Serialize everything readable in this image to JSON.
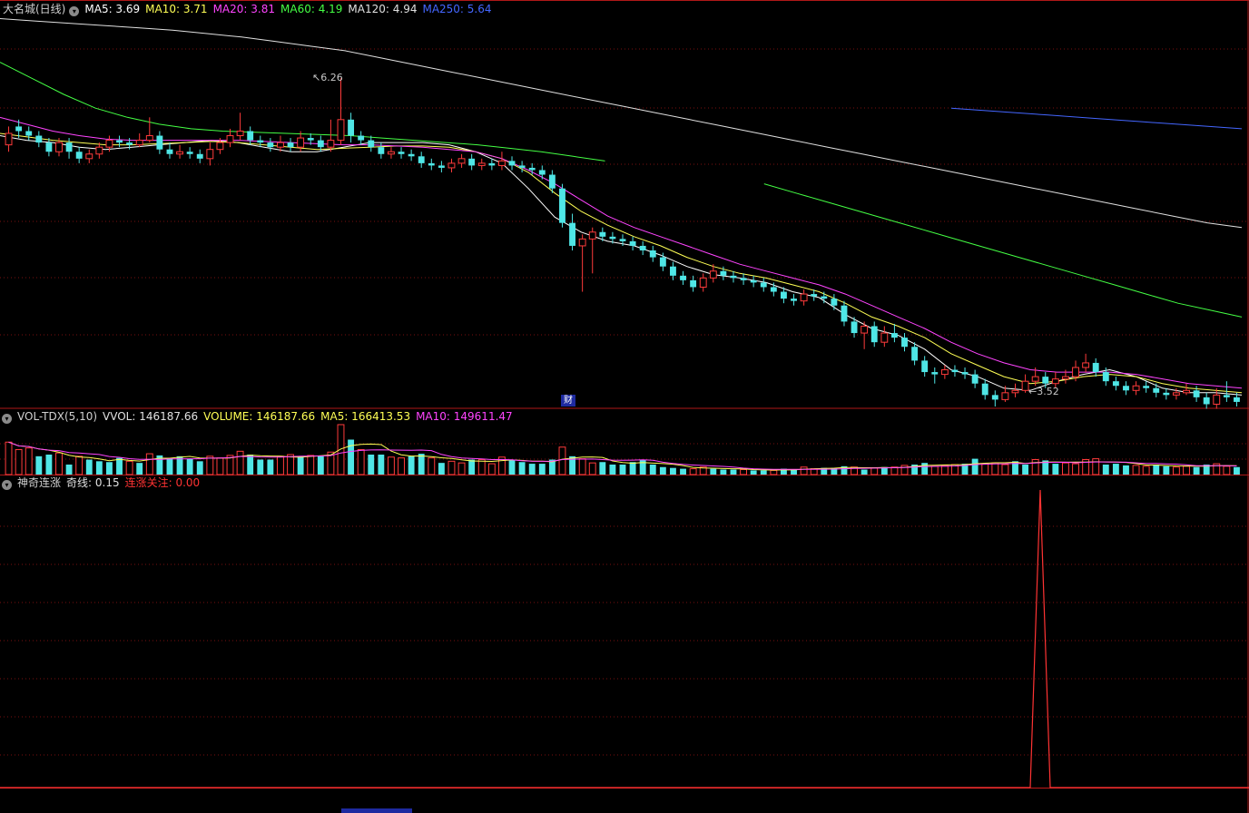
{
  "main_panel": {
    "title": "大名城(日线)",
    "indicators": [
      {
        "label": "MA5: 3.69",
        "color": "#ffffff"
      },
      {
        "label": "MA10: 3.71",
        "color": "#ffff55"
      },
      {
        "label": "MA20: 3.81",
        "color": "#ff44ff"
      },
      {
        "label": "MA60: 4.19",
        "color": "#44ff44"
      },
      {
        "label": "MA120: 4.94",
        "color": "#e0e0e0"
      },
      {
        "label": "MA250: 5.64",
        "color": "#4466ff"
      }
    ],
    "high_label": "6.26",
    "low_label": "3.52",
    "finance_badge": "财"
  },
  "volume_panel": {
    "title": "VOL-TDX(5,10)",
    "indicators": [
      {
        "label": "VVOL: 146187.66",
        "color": "#e0e0e0"
      },
      {
        "label": "VOLUME: 146187.66",
        "color": "#ffff55"
      },
      {
        "label": "MA5: 166413.53",
        "color": "#ffff55"
      },
      {
        "label": "MA10: 149611.47",
        "color": "#ff44ff"
      }
    ]
  },
  "signal_panel": {
    "title": "神奇连涨",
    "indicators": [
      {
        "label": "奇线: 0.15",
        "color": "#e0e0e0"
      },
      {
        "label": "连涨关注: 0.00",
        "color": "#ff3333"
      }
    ]
  },
  "chart_data": {
    "type": "candlestick",
    "price_range": [
      3.4,
      6.8
    ],
    "candles": [
      [
        5.68,
        5.78,
        5.84,
        5.62
      ],
      [
        5.84,
        5.8,
        5.9,
        5.74
      ],
      [
        5.8,
        5.76,
        5.84,
        5.72
      ],
      [
        5.76,
        5.7,
        5.8,
        5.66
      ],
      [
        5.7,
        5.62,
        5.74,
        5.58
      ],
      [
        5.62,
        5.7,
        5.74,
        5.58
      ],
      [
        5.7,
        5.62,
        5.74,
        5.56
      ],
      [
        5.62,
        5.56,
        5.66,
        5.52
      ],
      [
        5.56,
        5.6,
        5.64,
        5.52
      ],
      [
        5.6,
        5.66,
        5.7,
        5.56
      ],
      [
        5.66,
        5.72,
        5.76,
        5.62
      ],
      [
        5.72,
        5.7,
        5.76,
        5.66
      ],
      [
        5.7,
        5.68,
        5.74,
        5.64
      ],
      [
        5.68,
        5.72,
        5.78,
        5.66
      ],
      [
        5.72,
        5.76,
        5.92,
        5.7
      ],
      [
        5.76,
        5.64,
        5.8,
        5.6
      ],
      [
        5.64,
        5.6,
        5.7,
        5.56
      ],
      [
        5.6,
        5.62,
        5.68,
        5.56
      ],
      [
        5.62,
        5.6,
        5.66,
        5.56
      ],
      [
        5.6,
        5.56,
        5.64,
        5.52
      ],
      [
        5.56,
        5.64,
        5.7,
        5.5
      ],
      [
        5.64,
        5.7,
        5.74,
        5.6
      ],
      [
        5.7,
        5.76,
        5.82,
        5.66
      ],
      [
        5.76,
        5.8,
        5.96,
        5.72
      ],
      [
        5.8,
        5.72,
        5.84,
        5.68
      ],
      [
        5.72,
        5.7,
        5.76,
        5.66
      ],
      [
        5.7,
        5.66,
        5.74,
        5.62
      ],
      [
        5.66,
        5.7,
        5.76,
        5.62
      ],
      [
        5.7,
        5.66,
        5.74,
        5.62
      ],
      [
        5.66,
        5.74,
        5.8,
        5.62
      ],
      [
        5.74,
        5.72,
        5.78,
        5.68
      ],
      [
        5.72,
        5.66,
        5.76,
        5.62
      ],
      [
        5.66,
        5.72,
        5.9,
        5.62
      ],
      [
        5.72,
        5.9,
        6.26,
        5.68
      ],
      [
        5.9,
        5.76,
        5.96,
        5.7
      ],
      [
        5.76,
        5.72,
        5.8,
        5.68
      ],
      [
        5.72,
        5.66,
        5.76,
        5.62
      ],
      [
        5.66,
        5.6,
        5.7,
        5.56
      ],
      [
        5.6,
        5.62,
        5.66,
        5.56
      ],
      [
        5.62,
        5.6,
        5.66,
        5.56
      ],
      [
        5.6,
        5.58,
        5.64,
        5.54
      ],
      [
        5.58,
        5.52,
        5.62,
        5.48
      ],
      [
        5.52,
        5.5,
        5.56,
        5.46
      ],
      [
        5.5,
        5.48,
        5.54,
        5.44
      ],
      [
        5.48,
        5.52,
        5.56,
        5.44
      ],
      [
        5.52,
        5.56,
        5.6,
        5.48
      ],
      [
        5.56,
        5.5,
        5.6,
        5.46
      ],
      [
        5.5,
        5.52,
        5.56,
        5.46
      ],
      [
        5.52,
        5.5,
        5.56,
        5.46
      ],
      [
        5.5,
        5.54,
        5.62,
        5.46
      ],
      [
        5.54,
        5.5,
        5.58,
        5.46
      ],
      [
        5.5,
        5.48,
        5.54,
        5.44
      ],
      [
        5.48,
        5.46,
        5.52,
        5.42
      ],
      [
        5.46,
        5.42,
        5.5,
        5.38
      ],
      [
        5.42,
        5.3,
        5.46,
        5.26
      ],
      [
        5.3,
        5.0,
        5.34,
        4.96
      ],
      [
        5.0,
        4.8,
        5.08,
        4.76
      ],
      [
        4.8,
        4.86,
        4.9,
        4.4
      ],
      [
        4.86,
        4.92,
        4.96,
        4.56
      ],
      [
        4.92,
        4.88,
        4.96,
        4.84
      ],
      [
        4.88,
        4.86,
        4.92,
        4.82
      ],
      [
        4.86,
        4.84,
        4.9,
        4.8
      ],
      [
        4.84,
        4.8,
        4.88,
        4.76
      ],
      [
        4.8,
        4.76,
        4.84,
        4.72
      ],
      [
        4.76,
        4.7,
        4.8,
        4.66
      ],
      [
        4.7,
        4.62,
        4.74,
        4.58
      ],
      [
        4.62,
        4.54,
        4.66,
        4.5
      ],
      [
        4.54,
        4.5,
        4.58,
        4.46
      ],
      [
        4.5,
        4.44,
        4.54,
        4.4
      ],
      [
        4.44,
        4.52,
        4.56,
        4.4
      ],
      [
        4.52,
        4.58,
        4.64,
        4.48
      ],
      [
        4.58,
        4.54,
        4.62,
        4.5
      ],
      [
        4.54,
        4.52,
        4.58,
        4.48
      ],
      [
        4.52,
        4.5,
        4.56,
        4.46
      ],
      [
        4.5,
        4.48,
        4.54,
        4.44
      ],
      [
        4.48,
        4.44,
        4.52,
        4.4
      ],
      [
        4.44,
        4.4,
        4.48,
        4.36
      ],
      [
        4.4,
        4.34,
        4.44,
        4.3
      ],
      [
        4.34,
        4.32,
        4.38,
        4.28
      ],
      [
        4.32,
        4.38,
        4.42,
        4.28
      ],
      [
        4.38,
        4.36,
        4.42,
        4.32
      ],
      [
        4.36,
        4.34,
        4.4,
        4.3
      ],
      [
        4.34,
        4.28,
        4.38,
        4.24
      ],
      [
        4.28,
        4.14,
        4.32,
        4.1
      ],
      [
        4.14,
        4.04,
        4.18,
        4.0
      ],
      [
        4.04,
        4.1,
        4.14,
        3.9
      ],
      [
        4.1,
        3.96,
        4.14,
        3.92
      ],
      [
        3.96,
        4.04,
        4.1,
        3.92
      ],
      [
        4.04,
        4.0,
        4.12,
        3.96
      ],
      [
        4.0,
        3.92,
        4.04,
        3.88
      ],
      [
        3.92,
        3.8,
        3.96,
        3.76
      ],
      [
        3.8,
        3.7,
        3.84,
        3.66
      ],
      [
        3.7,
        3.68,
        3.74,
        3.6
      ],
      [
        3.68,
        3.72,
        3.76,
        3.64
      ],
      [
        3.72,
        3.7,
        3.76,
        3.66
      ],
      [
        3.7,
        3.68,
        3.74,
        3.64
      ],
      [
        3.68,
        3.6,
        3.72,
        3.56
      ],
      [
        3.6,
        3.5,
        3.64,
        3.46
      ],
      [
        3.5,
        3.46,
        3.54,
        3.4
      ],
      [
        3.46,
        3.52,
        3.58,
        3.44
      ],
      [
        3.52,
        3.54,
        3.6,
        3.48
      ],
      [
        3.54,
        3.62,
        3.68,
        3.52
      ],
      [
        3.62,
        3.66,
        3.74,
        3.58
      ],
      [
        3.66,
        3.6,
        3.7,
        3.56
      ],
      [
        3.6,
        3.64,
        3.7,
        3.56
      ],
      [
        3.64,
        3.66,
        3.72,
        3.6
      ],
      [
        3.66,
        3.74,
        3.8,
        3.62
      ],
      [
        3.74,
        3.78,
        3.86,
        3.7
      ],
      [
        3.78,
        3.7,
        3.82,
        3.66
      ],
      [
        3.7,
        3.62,
        3.74,
        3.58
      ],
      [
        3.62,
        3.58,
        3.66,
        3.54
      ],
      [
        3.58,
        3.54,
        3.62,
        3.5
      ],
      [
        3.54,
        3.58,
        3.62,
        3.5
      ],
      [
        3.58,
        3.56,
        3.62,
        3.52
      ],
      [
        3.56,
        3.52,
        3.6,
        3.48
      ],
      [
        3.52,
        3.5,
        3.56,
        3.46
      ],
      [
        3.5,
        3.52,
        3.56,
        3.46
      ],
      [
        3.52,
        3.54,
        3.6,
        3.5
      ],
      [
        3.54,
        3.48,
        3.58,
        3.44
      ],
      [
        3.48,
        3.42,
        3.52,
        3.38
      ],
      [
        3.42,
        3.5,
        3.56,
        3.38
      ],
      [
        3.5,
        3.48,
        3.62,
        3.44
      ],
      [
        3.48,
        3.44,
        3.52,
        3.4
      ]
    ],
    "ma_lines": {
      "MA5": {
        "color": "#ffffff",
        "values": [
          5.76,
          5.72,
          5.7,
          5.66,
          5.64,
          5.66,
          5.68,
          5.7,
          5.72,
          5.7,
          5.66,
          5.62,
          5.62,
          5.66,
          5.7,
          5.7,
          5.7,
          5.68,
          5.62,
          5.52,
          5.3,
          5.05,
          4.92,
          4.84,
          4.8,
          4.72,
          4.62,
          4.55,
          4.52,
          4.48,
          4.4,
          4.35,
          4.2,
          4.08,
          4.02,
          3.9,
          3.72,
          3.66,
          3.56,
          3.54,
          3.62,
          3.68,
          3.72,
          3.66,
          3.56,
          3.52,
          3.52,
          3.5
        ]
      },
      "MA10": {
        "color": "#ffff55",
        "values": [
          5.78,
          5.75,
          5.72,
          5.7,
          5.68,
          5.68,
          5.69,
          5.7,
          5.71,
          5.7,
          5.68,
          5.66,
          5.64,
          5.65,
          5.66,
          5.67,
          5.67,
          5.66,
          5.62,
          5.56,
          5.44,
          5.26,
          5.1,
          4.98,
          4.88,
          4.8,
          4.7,
          4.62,
          4.56,
          4.52,
          4.46,
          4.4,
          4.3,
          4.18,
          4.1,
          4.0,
          3.86,
          3.76,
          3.66,
          3.6,
          3.62,
          3.66,
          3.68,
          3.66,
          3.6,
          3.56,
          3.54,
          3.52
        ]
      },
      "MA20": {
        "color": "#ff44ff",
        "values": [
          5.92,
          5.86,
          5.8,
          5.76,
          5.73,
          5.72,
          5.72,
          5.72,
          5.72,
          5.72,
          5.71,
          5.7,
          5.69,
          5.68,
          5.68,
          5.67,
          5.66,
          5.64,
          5.62,
          5.56,
          5.46,
          5.34,
          5.2,
          5.06,
          4.96,
          4.88,
          4.8,
          4.72,
          4.64,
          4.58,
          4.52,
          4.46,
          4.38,
          4.28,
          4.18,
          4.08,
          3.96,
          3.86,
          3.78,
          3.72,
          3.7,
          3.7,
          3.7,
          3.68,
          3.64,
          3.6,
          3.58,
          3.56
        ]
      },
      "MA60": {
        "color": "#44ff44",
        "values": [
          6.4,
          6.26,
          6.12,
          6.0,
          5.92,
          5.86,
          5.82,
          5.8,
          5.79,
          5.78,
          5.77,
          5.76,
          5.74,
          5.72,
          5.7,
          5.68,
          5.65,
          5.62,
          5.58,
          5.54,
          null,
          null,
          null,
          null,
          5.34,
          5.26,
          5.18,
          5.1,
          5.02,
          4.94,
          4.86,
          4.78,
          4.7,
          4.62,
          4.54,
          4.46,
          4.38,
          4.3,
          4.24,
          4.18
        ]
      },
      "MA120": {
        "color": "#e0e0e0",
        "values": [
          6.78,
          6.76,
          6.74,
          6.72,
          6.7,
          6.68,
          6.65,
          6.62,
          6.58,
          6.54,
          6.5,
          6.44,
          6.38,
          6.32,
          6.26,
          6.2,
          6.14,
          6.08,
          6.02,
          5.96,
          5.9,
          5.84,
          5.78,
          5.72,
          5.66,
          5.6,
          5.54,
          5.48,
          5.42,
          5.36,
          5.3,
          5.24,
          5.18,
          5.12,
          5.06,
          5.0,
          4.96
        ]
      },
      "MA250": {
        "color": "#4466ff",
        "values": [
          6.0,
          5.97,
          5.94,
          5.91,
          5.88,
          5.85,
          5.82
        ]
      }
    },
    "volume": [
      [
        7.8,
        0
      ],
      [
        6.0,
        0
      ],
      [
        6.4,
        0
      ],
      [
        4.4,
        1
      ],
      [
        4.8,
        1
      ],
      [
        5.2,
        0
      ],
      [
        2.4,
        1
      ],
      [
        4.4,
        0
      ],
      [
        3.6,
        1
      ],
      [
        3.2,
        1
      ],
      [
        3.0,
        1
      ],
      [
        4.0,
        1
      ],
      [
        3.2,
        0
      ],
      [
        2.8,
        1
      ],
      [
        5.0,
        0
      ],
      [
        4.6,
        1
      ],
      [
        4.0,
        1
      ],
      [
        4.4,
        1
      ],
      [
        3.8,
        1
      ],
      [
        3.2,
        1
      ],
      [
        4.4,
        0
      ],
      [
        4.0,
        0
      ],
      [
        4.6,
        0
      ],
      [
        5.6,
        0
      ],
      [
        4.8,
        1
      ],
      [
        3.6,
        1
      ],
      [
        3.6,
        1
      ],
      [
        4.4,
        0
      ],
      [
        4.8,
        0
      ],
      [
        4.4,
        1
      ],
      [
        4.6,
        0
      ],
      [
        4.4,
        1
      ],
      [
        5.4,
        0
      ],
      [
        12.0,
        0
      ],
      [
        8.4,
        1
      ],
      [
        6.0,
        0
      ],
      [
        4.8,
        1
      ],
      [
        4.8,
        1
      ],
      [
        4.2,
        0
      ],
      [
        4.0,
        0
      ],
      [
        4.4,
        1
      ],
      [
        5.0,
        1
      ],
      [
        4.0,
        0
      ],
      [
        2.8,
        1
      ],
      [
        3.2,
        0
      ],
      [
        2.8,
        0
      ],
      [
        3.6,
        1
      ],
      [
        3.6,
        0
      ],
      [
        2.6,
        0
      ],
      [
        4.2,
        0
      ],
      [
        3.6,
        1
      ],
      [
        3.0,
        1
      ],
      [
        2.6,
        1
      ],
      [
        2.6,
        1
      ],
      [
        3.6,
        1
      ],
      [
        6.6,
        0
      ],
      [
        4.4,
        1
      ],
      [
        3.8,
        0
      ],
      [
        2.8,
        0
      ],
      [
        3.0,
        1
      ],
      [
        2.4,
        1
      ],
      [
        2.4,
        1
      ],
      [
        3.0,
        1
      ],
      [
        3.6,
        1
      ],
      [
        2.4,
        1
      ],
      [
        1.8,
        1
      ],
      [
        1.6,
        1
      ],
      [
        1.4,
        1
      ],
      [
        1.4,
        0
      ],
      [
        1.8,
        0
      ],
      [
        1.4,
        1
      ],
      [
        1.2,
        1
      ],
      [
        1.2,
        1
      ],
      [
        1.2,
        0
      ],
      [
        1.0,
        1
      ],
      [
        1.0,
        1
      ],
      [
        1.0,
        0
      ],
      [
        1.4,
        1
      ],
      [
        1.2,
        1
      ],
      [
        1.8,
        0
      ],
      [
        1.4,
        0
      ],
      [
        1.6,
        1
      ],
      [
        1.6,
        1
      ],
      [
        2.0,
        1
      ],
      [
        1.8,
        0
      ],
      [
        1.2,
        1
      ],
      [
        1.6,
        0
      ],
      [
        1.8,
        1
      ],
      [
        1.8,
        0
      ],
      [
        2.2,
        0
      ],
      [
        2.4,
        1
      ],
      [
        2.8,
        1
      ],
      [
        2.0,
        0
      ],
      [
        2.2,
        0
      ],
      [
        2.4,
        0
      ],
      [
        2.6,
        1
      ],
      [
        3.8,
        1
      ],
      [
        2.6,
        0
      ],
      [
        2.8,
        0
      ],
      [
        2.4,
        0
      ],
      [
        3.2,
        1
      ],
      [
        2.4,
        1
      ],
      [
        3.6,
        0
      ],
      [
        3.4,
        1
      ],
      [
        2.6,
        1
      ],
      [
        2.8,
        0
      ],
      [
        2.6,
        0
      ],
      [
        3.6,
        0
      ],
      [
        3.8,
        0
      ],
      [
        2.4,
        1
      ],
      [
        2.6,
        1
      ],
      [
        2.2,
        1
      ],
      [
        2.2,
        0
      ],
      [
        2.0,
        0
      ],
      [
        2.4,
        1
      ],
      [
        2.0,
        1
      ],
      [
        1.8,
        0
      ],
      [
        2.0,
        0
      ],
      [
        1.8,
        1
      ],
      [
        2.4,
        1
      ],
      [
        2.6,
        0
      ],
      [
        2.0,
        0
      ],
      [
        1.8,
        1
      ]
    ],
    "signal_line": {
      "color": "#ff3333",
      "peak_index": 105,
      "peak_value": 1.0,
      "baseline": 0.0
    }
  }
}
